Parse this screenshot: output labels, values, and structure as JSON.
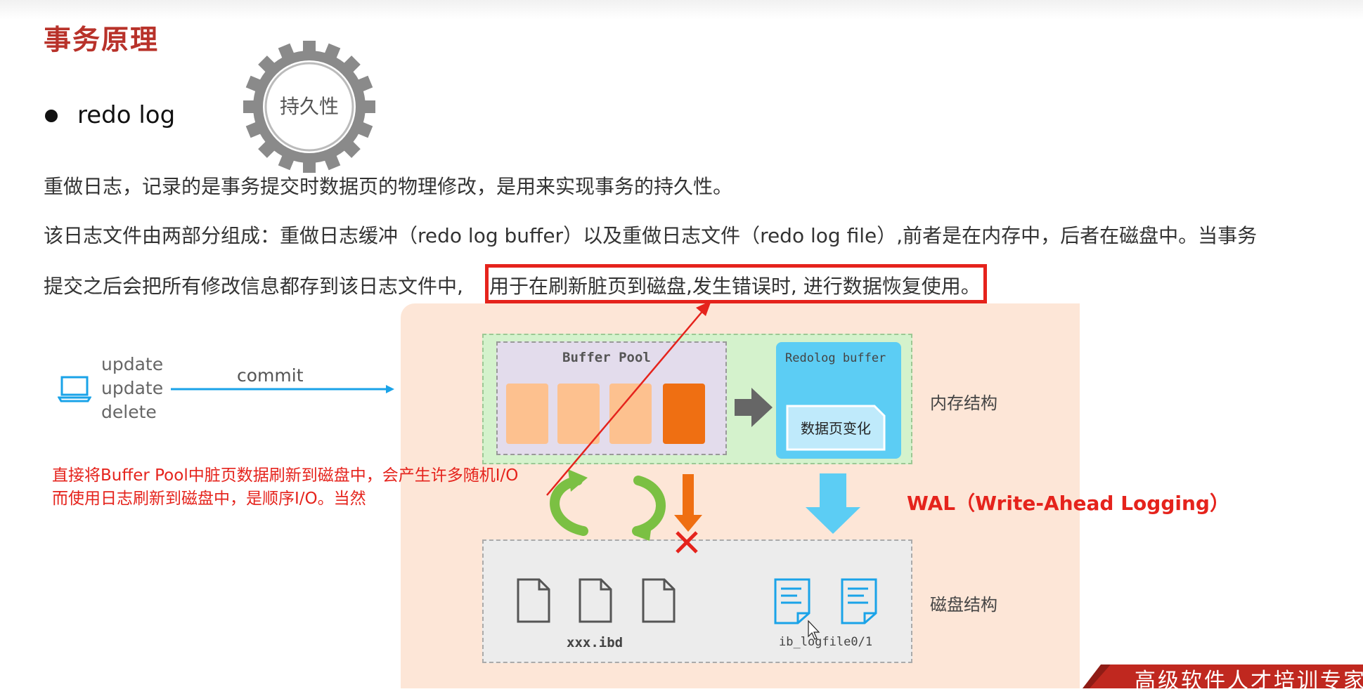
{
  "title": "事务原理",
  "bullet": "redo log",
  "gear_label": "持久性",
  "paragraphs": {
    "p1": "重做日志，记录的是事务提交时数据页的物理修改，是用来实现事务的持久性。",
    "p2": "该日志文件由两部分组成：重做日志缓冲（redo log buffer）以及重做日志文件（redo log file）,前者是在内存中，后者在磁盘中。当事务",
    "p3_prefix": "提交之后会把所有修改信息都存到该日志文件中,",
    "p3_highlight": "用于在刷新脏页到磁盘,发生错误时, 进行数据恢复使用。"
  },
  "client": {
    "ops": [
      "update",
      "update",
      "delete"
    ],
    "commit_label": "commit",
    "icon": "laptop-icon"
  },
  "red_note": {
    "line1": "直接将Buffer Pool中脏页数据刷新到磁盘中，会产生许多随机I/O",
    "line2": "而使用日志刷新到磁盘中，是顺序I/O。当然"
  },
  "memory": {
    "buffer_pool_title": "Buffer Pool",
    "redolog_buffer_title": "Redolog buffer",
    "redolog_inner_label": "数据页变化",
    "label": "内存结构"
  },
  "disk": {
    "ibd_label": "xxx.ibd",
    "logfile_label": "ib_logfile0/1",
    "label": "磁盘结构"
  },
  "wal_label": "WAL（Write-Ahead Logging）",
  "banner": "高级软件人才培训专家",
  "colors": {
    "title_red": "#b8322a",
    "highlight_red": "#e5231c",
    "panel_peach": "#fde6d7",
    "memory_green": "#d4f2cc",
    "buffer_pool_purple": "#e3dcec",
    "page_light": "#fdc18f",
    "page_dark": "#ef6f12",
    "redolog_blue": "#5ccdf4",
    "sync_green": "#7bc043",
    "commit_blue": "#1aa3e8"
  }
}
